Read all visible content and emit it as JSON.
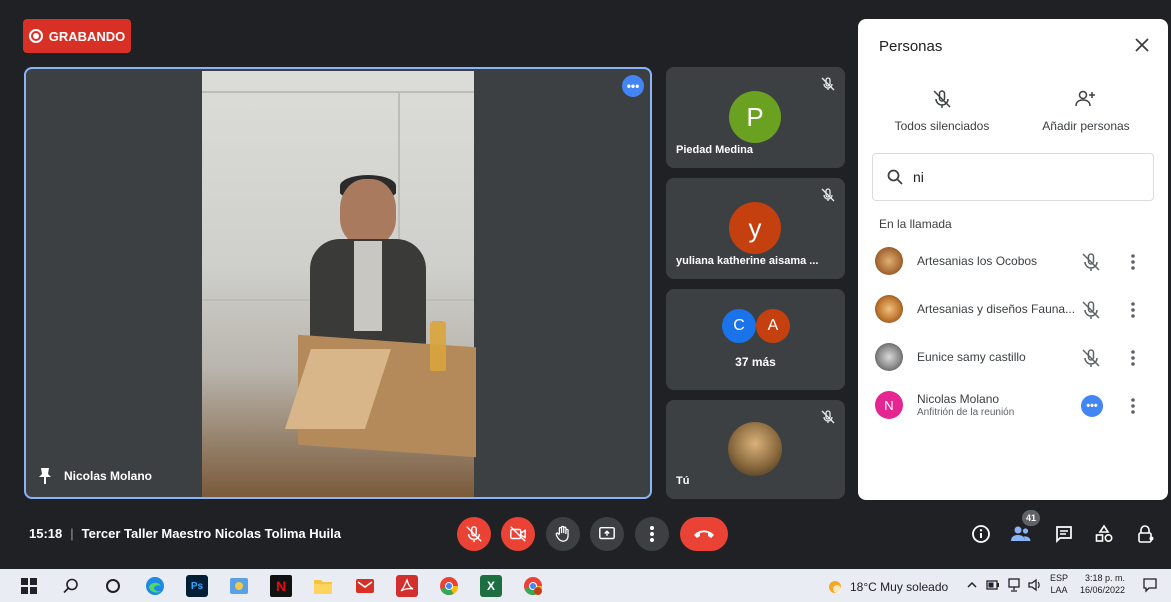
{
  "recording": {
    "label": "GRABANDO"
  },
  "main_tile": {
    "name": "Nicolas Molano"
  },
  "side_tiles": [
    {
      "initial": "P",
      "name": "Piedad Medina",
      "color": "#6aa121"
    },
    {
      "initial": "y",
      "name": "yuliana katherine aisama ...",
      "color": "#c5400f"
    },
    {
      "initials": [
        "C",
        "A"
      ],
      "colors": [
        "#1a73e8",
        "#c5400f"
      ],
      "more": "37 más"
    },
    {
      "name": "Tú"
    }
  ],
  "people_panel": {
    "title": "Personas",
    "actions": {
      "mute_all": "Todos silenciados",
      "add_people": "Añadir personas"
    },
    "search": {
      "value": "ni"
    },
    "section": "En la llamada",
    "participants": [
      {
        "name": "Artesanias los Ocobos"
      },
      {
        "name": "Artesanias y diseños Fauna..."
      },
      {
        "name": "Eunice samy castillo"
      },
      {
        "name": "Nicolas Molano",
        "role": "Anfitrión de la reunión",
        "initial": "N",
        "color": "#e52592"
      }
    ]
  },
  "bottom_bar": {
    "time": "15:18",
    "meeting_title": "Tercer Taller Maestro Nicolas Tolima Huila",
    "people_count": "41"
  },
  "taskbar": {
    "weather": "18°C  Muy soleado",
    "lang_top": "ESP",
    "lang_bottom": "LAA",
    "time": "3:18 p. m.",
    "date": "16/06/2022"
  },
  "colors": {
    "accent": "#8ab4f8",
    "danger": "#ea4335",
    "surface": "#3c4043",
    "background": "#202124"
  }
}
